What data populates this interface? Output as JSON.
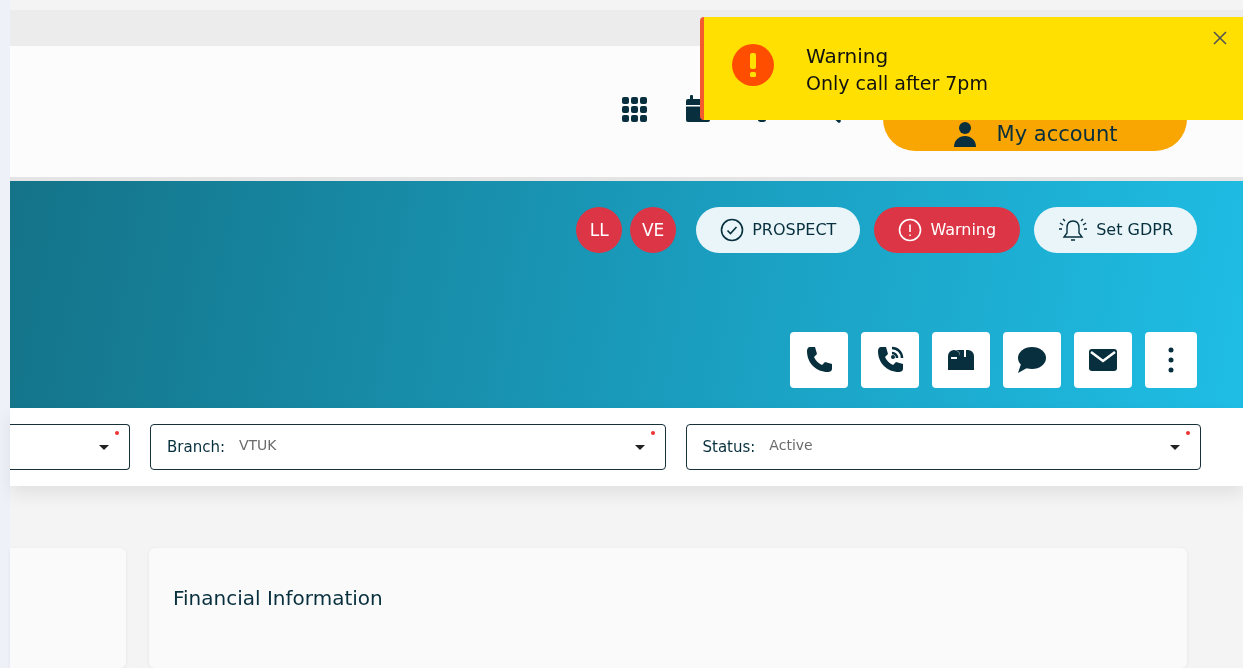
{
  "toast": {
    "title": "Warning",
    "message": "Only call after 7pm"
  },
  "header": {
    "account_button": "My account"
  },
  "initials": [
    {
      "text": "LL"
    },
    {
      "text": "VE"
    }
  ],
  "pills": [
    {
      "kind": "prospect",
      "label": "PROSPECT"
    },
    {
      "kind": "warning",
      "label": "Warning"
    },
    {
      "kind": "gdpr",
      "label": "Set GDPR"
    }
  ],
  "fields": [
    {
      "required": true
    },
    {
      "label": "Branch:",
      "value": "VTUK",
      "required": true
    },
    {
      "label": "Status:",
      "value": "Active",
      "required": true
    }
  ],
  "section_title": "Financial Information"
}
